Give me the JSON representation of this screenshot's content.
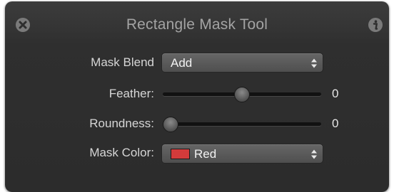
{
  "window": {
    "title": "Rectangle Mask Tool",
    "close_icon": "close-icon",
    "info_icon": "info-icon"
  },
  "mask_blend": {
    "label": "Mask Blend",
    "value": "Add"
  },
  "feather": {
    "label": "Feather:",
    "value": "0",
    "level": 0.5
  },
  "roundness": {
    "label": "Roundness:",
    "value": "0",
    "level": 0
  },
  "mask_color": {
    "label": "Mask Color:",
    "value": "Red",
    "swatch_color": "#d23b3b"
  }
}
